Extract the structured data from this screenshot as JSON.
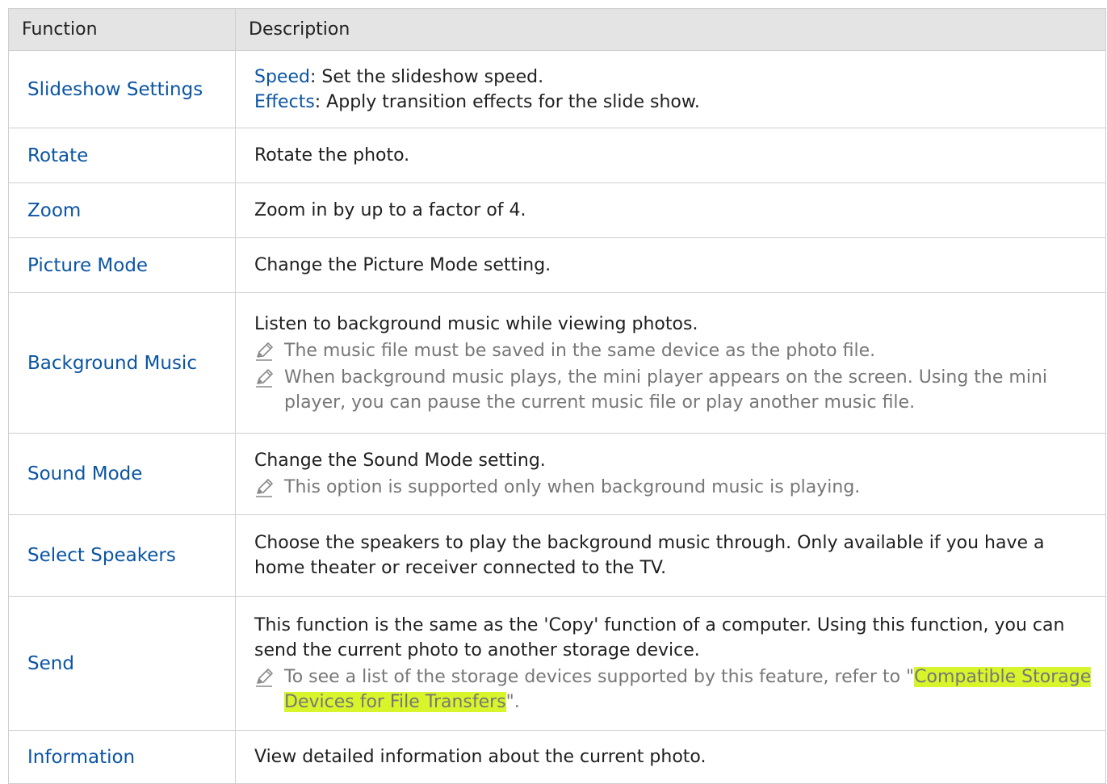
{
  "header": {
    "col1": "Function",
    "col2": "Description"
  },
  "rows": [
    {
      "function": "Slideshow Settings",
      "speed_label": "Speed",
      "speed_text": ": Set the slideshow speed.",
      "effects_label": "Effects",
      "effects_text": ": Apply transition effects for the slide show."
    },
    {
      "function": "Rotate",
      "desc": "Rotate the photo."
    },
    {
      "function": "Zoom",
      "desc": "Zoom in by up to a factor of 4."
    },
    {
      "function": "Picture Mode",
      "desc": "Change the Picture Mode setting."
    },
    {
      "function": "Background Music",
      "desc": "Listen to background music while viewing photos.",
      "note1": "The music file must be saved in the same device as the photo file.",
      "note2": "When background music plays, the mini player appears on the screen. Using the mini player, you can pause the current music file or play another music file."
    },
    {
      "function": "Sound Mode",
      "desc": "Change the Sound Mode setting.",
      "note1": "This option is supported only when background music is playing."
    },
    {
      "function": "Select Speakers",
      "desc": "Choose the speakers to play the background music through. Only available if you have a home theater or receiver connected to the TV."
    },
    {
      "function": "Send",
      "desc": "This function is the same as the 'Copy' function of a computer. Using this function, you can send the current photo to another storage device.",
      "note_pre": "To see a list of the storage devices supported by this feature, refer to \"",
      "note_link": "Compatible Storage Devices for File Transfers",
      "note_post": "\"."
    },
    {
      "function": "Information",
      "desc": "View detailed information about the current photo."
    }
  ],
  "icons": {
    "note": "pencil-note-icon"
  },
  "colors": {
    "function_text": "#0b55a3",
    "note_text": "#777777",
    "highlight": "#d8f52b",
    "header_bg": "#e4e4e4"
  }
}
